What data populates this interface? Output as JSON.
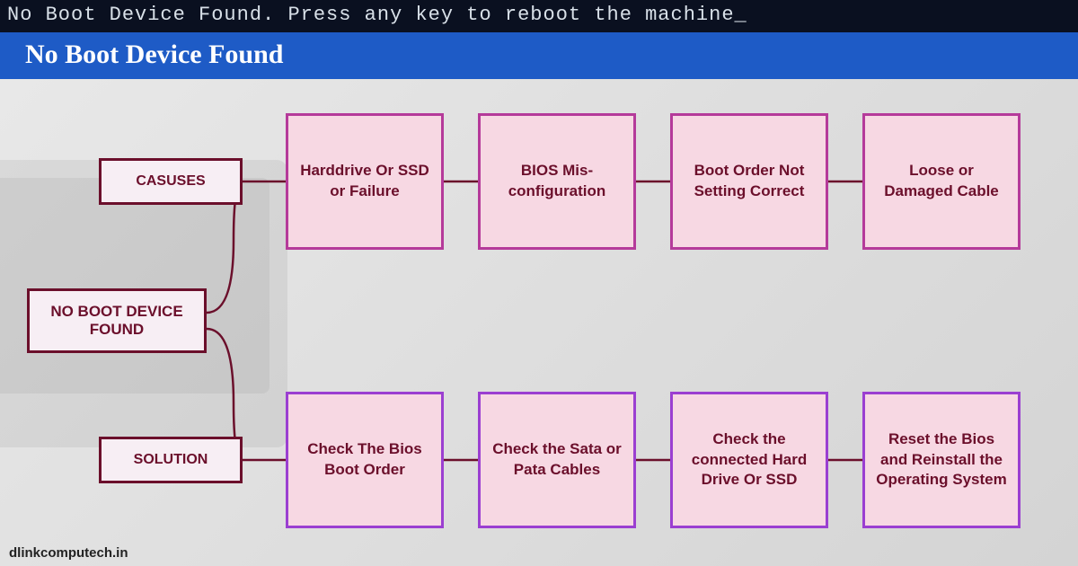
{
  "terminal_text": "No Boot Device Found. Press any key to reboot the machine_",
  "title": "No Boot Device Found",
  "root_label": "NO BOOT DEVICE FOUND",
  "branches": {
    "causes": {
      "label": "CASUSES",
      "items": [
        "Harddrive Or SSD or Failure",
        "BIOS Mis-configuration",
        "Boot Order Not Setting Correct",
        "Loose or Damaged Cable"
      ]
    },
    "solution": {
      "label": "SOLUTION",
      "items": [
        "Check The Bios Boot Order",
        "Check the Sata or Pata Cables",
        "Check the connected Hard Drive Or SSD",
        "Reset the Bios and Reinstall the Operating System"
      ]
    }
  },
  "footer": "dlinkcomputech.in",
  "colors": {
    "title_bg": "#1e5bc6",
    "dark_maroon": "#6b0f2b",
    "causes_border": "#b53a9a",
    "solution_border": "#9b3fd1",
    "card_fill": "#f7d8e3"
  }
}
